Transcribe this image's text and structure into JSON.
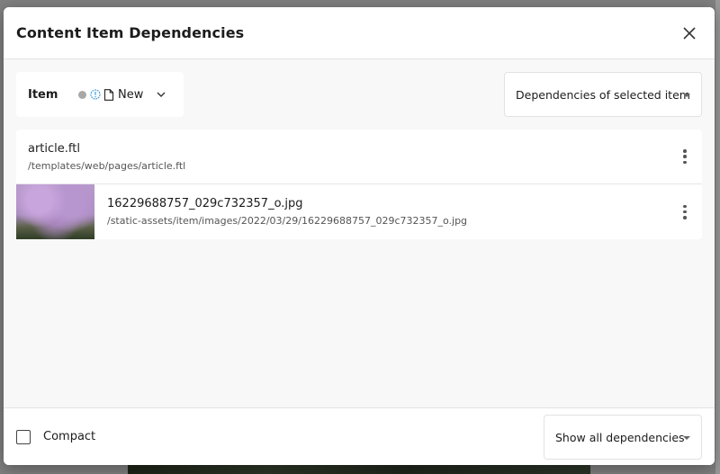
{
  "dialog": {
    "title": "Content Item Dependencies",
    "close_icon": "close-icon"
  },
  "toolbar": {
    "item_label": "Item",
    "item": {
      "state_icon": "gray-dot",
      "status_icon": "info-circle-icon",
      "type_icon": "file-icon",
      "name": "New",
      "expand_icon": "chevron-down-icon"
    },
    "dependency_mode": {
      "selected": "Dependencies of selected item"
    }
  },
  "dependencies": [
    {
      "name": "article.ftl",
      "path": "/templates/web/pages/article.ftl",
      "has_thumbnail": false
    },
    {
      "name": "16229688757_029c732357_o.jpg",
      "path": "/static-assets/item/images/2022/03/29/16229688757_029c732357_o.jpg",
      "has_thumbnail": true
    }
  ],
  "footer": {
    "compact_label": "Compact",
    "compact_checked": false,
    "show_filter": {
      "selected": "Show all dependencies"
    }
  },
  "colors": {
    "info_accent": "#3d9de0",
    "state_dot": "#a8a8a8"
  }
}
